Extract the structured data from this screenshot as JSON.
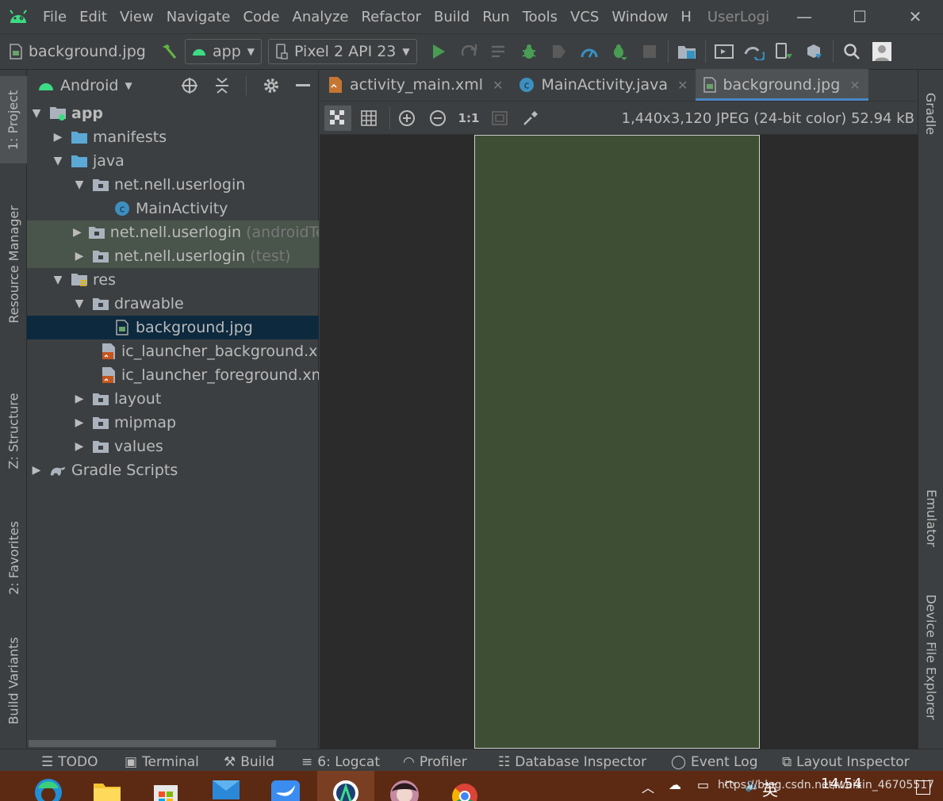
{
  "menubar": {
    "items": [
      "File",
      "Edit",
      "View",
      "Navigate",
      "Code",
      "Analyze",
      "Refactor",
      "Build",
      "Run",
      "Tools",
      "VCS",
      "Window",
      "H"
    ],
    "app_title": "UserLogi",
    "minimize": "—",
    "maximize": "☐",
    "close": "✕"
  },
  "toolbar": {
    "file_name": "background.jpg",
    "module_combo": "app",
    "device_combo": "Pixel 2 API 23"
  },
  "left_strip": {
    "project": "1: Project",
    "resource_manager": "Resource Manager",
    "structure": "Z: Structure",
    "favorites": "2: Favorites",
    "build_variants": "Build Variants"
  },
  "right_strip": {
    "gradle": "Gradle",
    "emulator": "Emulator",
    "device_file_explorer": "Device File Explorer"
  },
  "project": {
    "view_mode": "Android",
    "tree": {
      "app": "app",
      "manifests": "manifests",
      "java": "java",
      "pkg_main": "net.nell.userlogin",
      "main_activity": "MainActivity",
      "pkg_android_test": "net.nell.userlogin",
      "pkg_android_test_suffix": "(androidTest)",
      "pkg_test": "net.nell.userlogin",
      "pkg_test_suffix": "(test)",
      "res": "res",
      "drawable": "drawable",
      "background": "background.jpg",
      "ic_bg": "ic_launcher_background.xml",
      "ic_fg": "ic_launcher_foreground.xml",
      "layout": "layout",
      "mipmap": "mipmap",
      "values": "values",
      "gradle_scripts": "Gradle Scripts"
    }
  },
  "editor": {
    "tabs": [
      "activity_main.xml",
      "MainActivity.java",
      "background.jpg"
    ],
    "active_tab": 2,
    "zoom_actual": "1:1",
    "image_info": "1,440x3,120 JPEG (24-bit color) 52.94 kB",
    "preview_color": "#3e4e34"
  },
  "bottombar": {
    "todo": "TODO",
    "terminal": "Terminal",
    "build": "Build",
    "logcat": "6: Logcat",
    "profiler": "Profiler",
    "db_inspector": "Database Inspector",
    "event_log": "Event Log",
    "layout_inspector": "Layout Inspector"
  },
  "taskbar": {
    "time": "14:54",
    "ime": "英",
    "watermark": "https://blog.csdn.net/weixin_46705517"
  },
  "colors": {
    "accent_green": "#3fb950",
    "android_green": "#a4c639",
    "folder_blue": "#5ca9d6",
    "tab_underline": "#4a88c7"
  }
}
